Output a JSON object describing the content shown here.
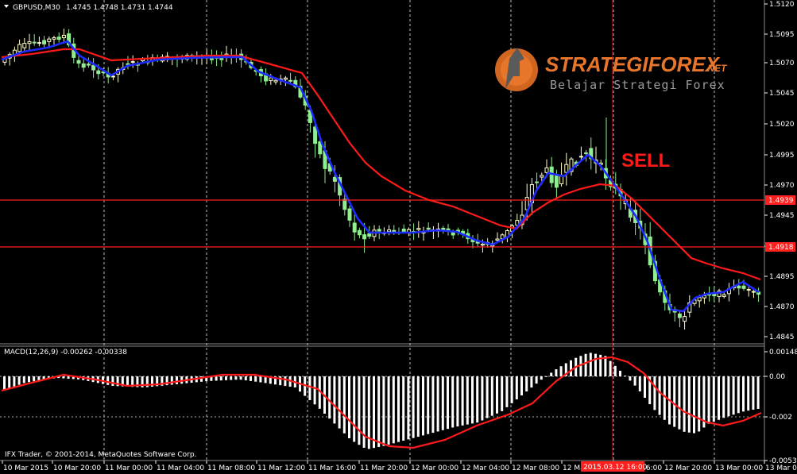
{
  "header": {
    "symbol_tf": "GBPUSD,M30",
    "ohlc": "1.4745 1.4748 1.4731 1.4744"
  },
  "macd": {
    "label": "MACD(12,26,9) -0.00262 -0.00338"
  },
  "footer": {
    "copyright": "IFX Trader, © 2001-2014, MetaQuotes Software Corp."
  },
  "annotation": {
    "sell": "SELL"
  },
  "logo": {
    "name": "STRATEGIFOREX",
    "tld": ".NET",
    "tagline": "Belajar Strategi Forex"
  },
  "price_axis": [
    "1.5120",
    "1.5095",
    "1.5070",
    "1.5045",
    "1.5020",
    "1.4995",
    "1.4970",
    "1.4945",
    "1.4920",
    "1.4895",
    "1.4870",
    "1.4845"
  ],
  "macd_axis": [
    "0.00148",
    "0.00",
    "-0.002",
    "-0.00539"
  ],
  "time_axis": [
    "10 Mar 2015",
    "10 Mar 20:00",
    "11 Mar 00:00",
    "11 Mar 04:00",
    "11 Mar 08:00",
    "11 Mar 12:00",
    "11 Mar 16:00",
    "11 Mar 20:00",
    "12 Mar 00:00",
    "12 Mar 04:00",
    "12 Mar 08:00",
    "12 Mar 12:00",
    "12 Mar 16:00",
    "12 Mar 20:00",
    "13 Mar 00:00",
    "13 Mar 04:00"
  ],
  "levels": [
    {
      "price": "1.4939",
      "color": "#ff2020"
    },
    {
      "price": "1.4918",
      "color": "#ff2020"
    }
  ],
  "crosshair": {
    "time": "2015.03.12 16:00"
  },
  "colors": {
    "background": "#000000",
    "bull_candle": "#ffffcc",
    "bear_candle": "#90ee90",
    "ma_fast": "#1e2bff",
    "ma_slow": "#ff1a1a",
    "macd_hist": "#ffffff",
    "macd_signal": "#ff1a1a",
    "level_line": "#ff2020"
  }
}
